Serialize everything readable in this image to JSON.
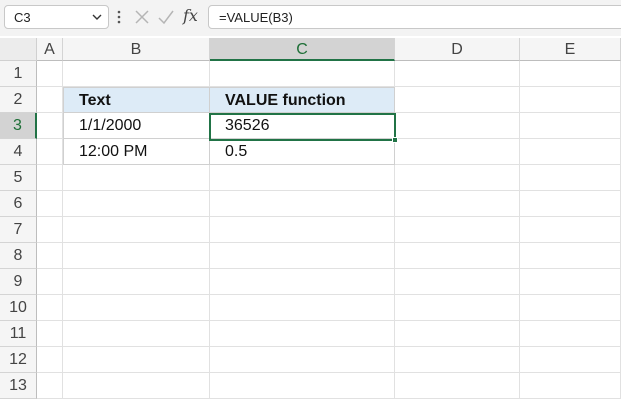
{
  "formula_bar": {
    "name_box": "C3",
    "formula": "=VALUE(B3)",
    "fx_label": "fx"
  },
  "columns": [
    "A",
    "B",
    "C",
    "D",
    "E"
  ],
  "selected_column": "C",
  "rows": [
    "1",
    "2",
    "3",
    "4",
    "5",
    "6",
    "7",
    "8",
    "9",
    "10",
    "11",
    "12",
    "13"
  ],
  "selected_row": "3",
  "table": {
    "headers": [
      "Text",
      "VALUE function"
    ],
    "rows": [
      [
        "1/1/2000",
        "36526"
      ],
      [
        "12:00 PM",
        "0.5"
      ]
    ],
    "header_color": "#ddebf7"
  },
  "colors": {
    "accent": "#217346"
  }
}
